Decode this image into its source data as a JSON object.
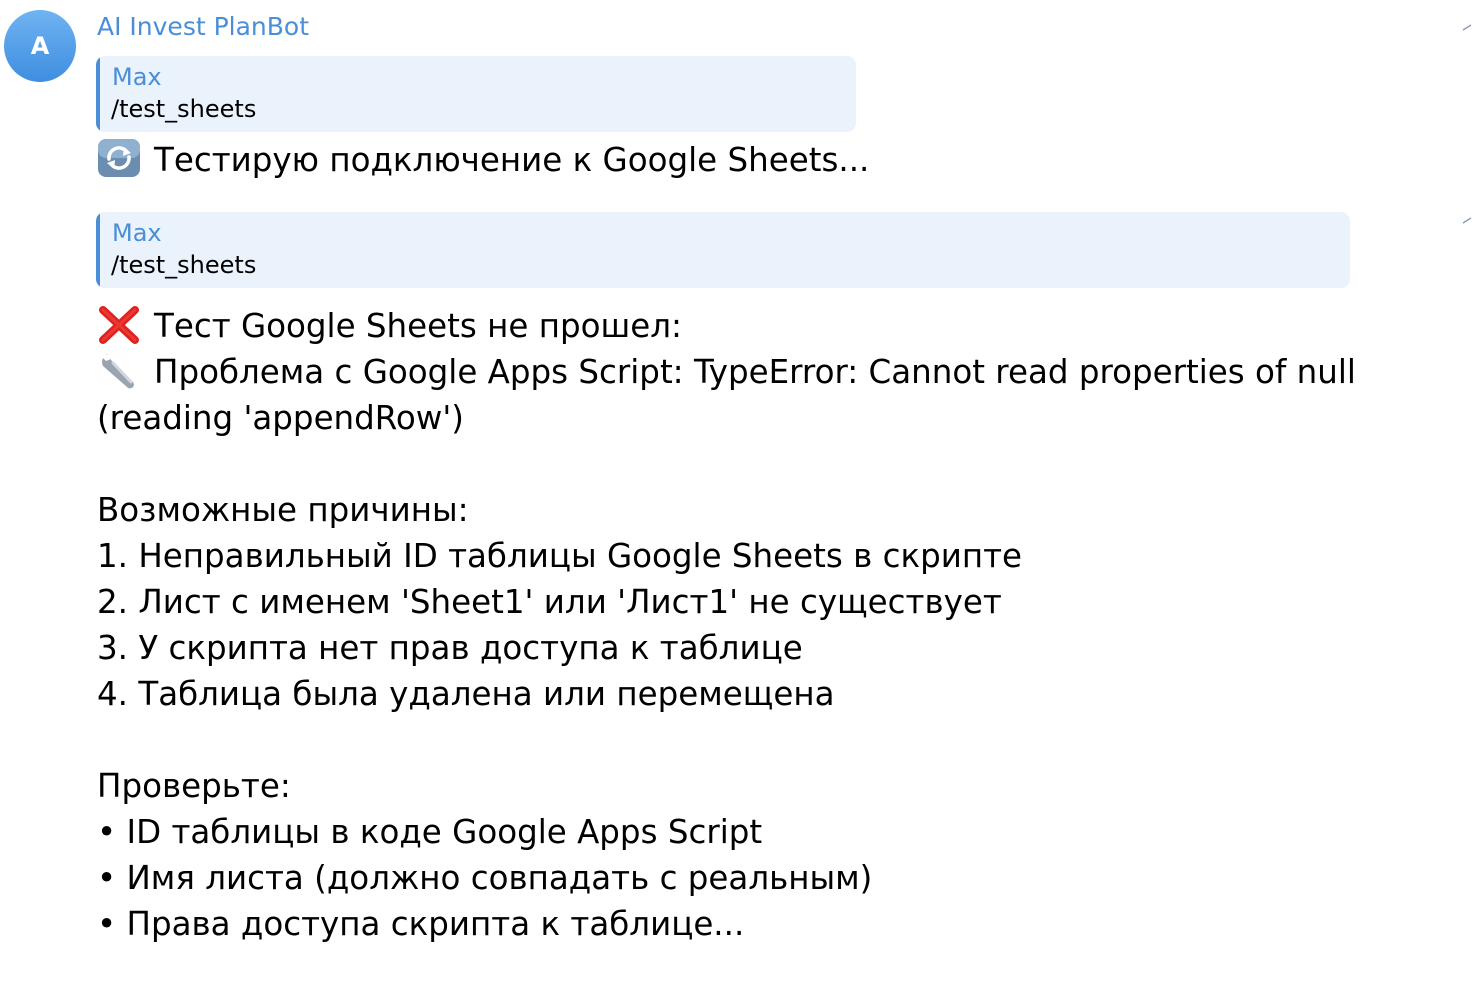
{
  "bot": {
    "name": "AI Invest PlanBot",
    "avatar_letter": "A"
  },
  "messages": [
    {
      "reply": {
        "author": "Max",
        "text": "/test_sheets"
      },
      "icon": "refresh-icon",
      "text": "Тестирую подключение к Google Sheets..."
    },
    {
      "reply": {
        "author": "Max",
        "text": "/test_sheets"
      },
      "lines": [
        {
          "icon": "cross-icon",
          "text": "Тест Google Sheets не прошел:"
        },
        {
          "icon": "wrench-icon",
          "text": "Проблема с Google Apps Script: TypeError: Cannot read properties of null"
        },
        {
          "text": "(reading 'appendRow')"
        },
        {
          "text": ""
        },
        {
          "text": "Возможные причины:"
        },
        {
          "text": "1. Неправильный ID таблицы Google Sheets в скрипте"
        },
        {
          "text": "2. Лист с именем 'Sheet1' или 'Лист1' не существует"
        },
        {
          "text": "3. У скрипта нет прав доступа к таблице"
        },
        {
          "text": "4. Таблица была удалена или перемещена"
        },
        {
          "text": ""
        },
        {
          "text": "Проверьте:"
        },
        {
          "text": "• ID таблицы в коде Google Apps Script"
        },
        {
          "text": "• Имя листа (должно совпадать с реальным)"
        },
        {
          "text": "• Права доступа скрипта к таблице..."
        }
      ]
    }
  ],
  "colors": {
    "accent": "#4a8ed8",
    "reply_bg": "#eaf2fb",
    "text": "#000000"
  }
}
